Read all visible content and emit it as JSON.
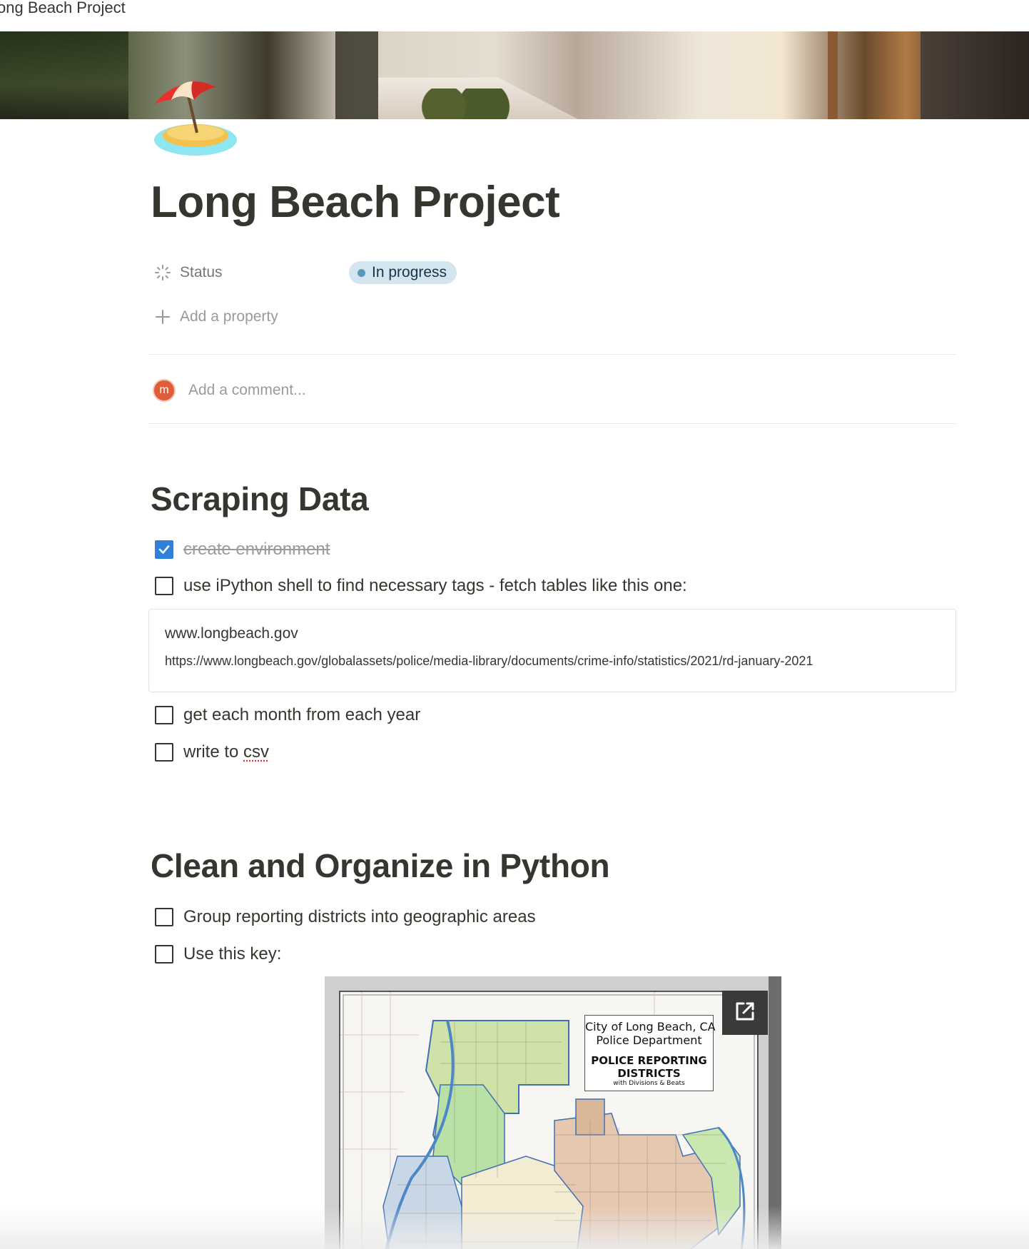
{
  "tab": {
    "title": "ong Beach Project"
  },
  "page": {
    "icon": "beach-umbrella-island-icon",
    "title": "Long Beach Project"
  },
  "properties": {
    "status_label": "Status",
    "status_value": "In progress",
    "status_color": "#5b97bd",
    "add_property": "Add a property"
  },
  "comment": {
    "avatar_initial": "m",
    "placeholder": "Add a comment..."
  },
  "sections": [
    {
      "heading": "Scraping Data",
      "todos": [
        {
          "text": "create environment",
          "checked": true
        },
        {
          "text": "use iPython shell to find necessary tags - fetch tables like this one:",
          "checked": false
        }
      ],
      "bookmark": {
        "title": "www.longbeach.gov",
        "url": "https://www.longbeach.gov/globalassets/police/media-library/documents/crime-info/statistics/2021/rd-january-2021"
      },
      "todos_after": [
        {
          "text": "get each month from each year",
          "checked": false
        },
        {
          "text_prefix": "write to ",
          "text_flagged": "csv",
          "checked": false
        }
      ]
    },
    {
      "heading": "Clean and Organize in Python",
      "todos": [
        {
          "text": "Group reporting districts into geographic areas",
          "checked": false
        },
        {
          "text": "Use this key:",
          "checked": false
        }
      ],
      "map_image": {
        "line1": "City of Long Beach, CA",
        "line2": "Police Department",
        "line3": "POLICE REPORTING",
        "line4": "DISTRICTS",
        "line5": "with Divisions & Beats"
      }
    }
  ],
  "accent_color": "#2f80d6"
}
